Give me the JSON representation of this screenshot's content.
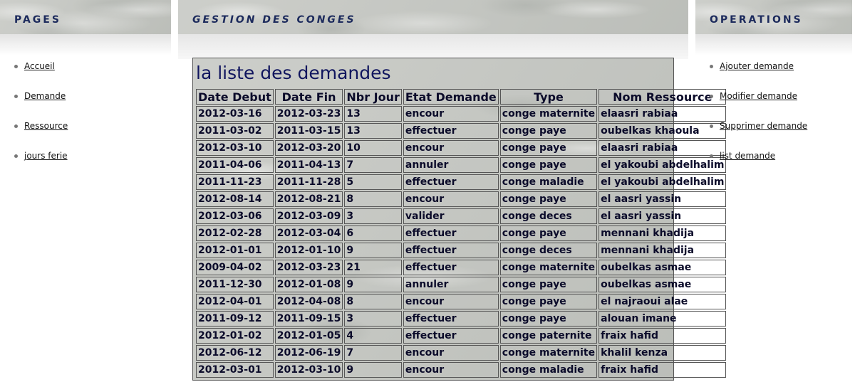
{
  "left": {
    "title": "PAGES",
    "links": [
      {
        "label": "Accueil"
      },
      {
        "label": "Demande"
      },
      {
        "label": "Ressource"
      },
      {
        "label": "jours ferie"
      }
    ]
  },
  "main": {
    "title": "GESTION DES CONGES",
    "table_title": "la liste des demandes",
    "columns": [
      "Date Debut",
      "Date Fin",
      "Nbr Jour",
      "Etat Demande",
      "Type",
      "Nom Ressource"
    ],
    "rows": [
      [
        "2012-03-16",
        "2012-03-23",
        "13",
        "encour",
        "conge maternite",
        "elaasri rabiaa"
      ],
      [
        "2011-03-02",
        "2011-03-15",
        "13",
        "effectuer",
        "conge paye",
        "oubelkas khaoula"
      ],
      [
        "2012-03-10",
        "2012-03-20",
        "10",
        "encour",
        "conge paye",
        "elaasri rabiaa"
      ],
      [
        "2011-04-06",
        "2011-04-13",
        "7",
        "annuler",
        "conge paye",
        "el yakoubi abdelhalim"
      ],
      [
        "2011-11-23",
        "2011-11-28",
        "5",
        "effectuer",
        "conge maladie",
        "el yakoubi abdelhalim"
      ],
      [
        "2012-08-14",
        "2012-08-21",
        "8",
        "encour",
        "conge paye",
        "el aasri yassin"
      ],
      [
        "2012-03-06",
        "2012-03-09",
        "3",
        "valider",
        "conge deces",
        "el aasri yassin"
      ],
      [
        "2012-02-28",
        "2012-03-04",
        "6",
        "effectuer",
        "conge paye",
        "mennani khadija"
      ],
      [
        "2012-01-01",
        "2012-01-10",
        "9",
        "effectuer",
        "conge deces",
        "mennani khadija"
      ],
      [
        "2009-04-02",
        "2012-03-23",
        "21",
        "effectuer",
        "conge maternite",
        "oubelkas asmae"
      ],
      [
        "2011-12-30",
        "2012-01-08",
        "9",
        "annuler",
        "conge paye",
        "oubelkas asmae"
      ],
      [
        "2012-04-01",
        "2012-04-08",
        "8",
        "encour",
        "conge paye",
        "el najraoui alae"
      ],
      [
        "2011-09-12",
        "2011-09-15",
        "3",
        "effectuer",
        "conge paye",
        "alouan imane"
      ],
      [
        "2012-01-02",
        "2012-01-05",
        "4",
        "effectuer",
        "conge paternite",
        "fraix hafid"
      ],
      [
        "2012-06-12",
        "2012-06-19",
        "7",
        "encour",
        "conge maternite",
        "khalil kenza"
      ],
      [
        "2012-03-01",
        "2012-03-10",
        "9",
        "encour",
        "conge maladie",
        "fraix hafid"
      ]
    ]
  },
  "right": {
    "title": "OPERATIONS",
    "links": [
      {
        "label": "Ajouter demande"
      },
      {
        "label": "Modifier demande"
      },
      {
        "label": "Supprimer demande"
      },
      {
        "label": "list demande"
      }
    ]
  }
}
